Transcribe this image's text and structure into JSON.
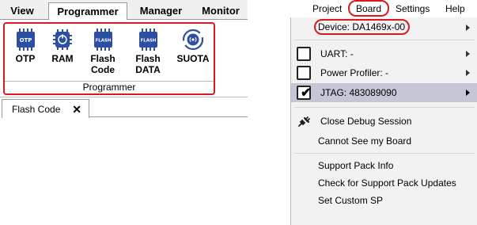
{
  "ribbon": {
    "tabs": [
      "View",
      "Programmer",
      "Manager",
      "Monitor"
    ],
    "group_label": "Programmer",
    "buttons": {
      "otp": "OTP",
      "ram": "RAM",
      "flash_code_l1": "Flash",
      "flash_code_l2": "Code",
      "flash_data_l1": "Flash",
      "flash_data_l2": "DATA",
      "suota": "SUOTA"
    },
    "icons": {
      "otp_text": "OTP",
      "flash_text": "FLASH"
    }
  },
  "doc_tab": {
    "label": "Flash Code",
    "close": "✕"
  },
  "menubar": {
    "items": [
      "Project",
      "Board",
      "Settings",
      "Help"
    ]
  },
  "board_menu": {
    "device": "Device: DA1469x-00",
    "uart": "UART: -",
    "power_profiler": "Power Profiler: -",
    "jtag": "JTAG: 483089090",
    "close_debug": "Close Debug Session",
    "cannot_see": "Cannot See my Board",
    "support_pack_info": "Support Pack Info",
    "support_pack_updates": "Check for Support Pack Updates",
    "set_custom_sp": "Set Custom SP"
  },
  "colors": {
    "highlight": "#d71920",
    "icon_blue": "#2d4fa3",
    "selected_row": "#c5c7d6"
  }
}
